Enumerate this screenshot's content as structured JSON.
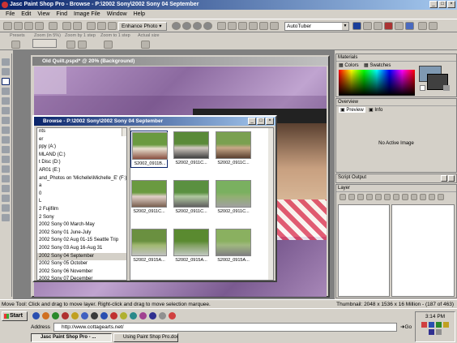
{
  "app": {
    "title": "Jasc Paint Shop Pro - Browse - P:\\2002 Sony\\2002 Sony 04 September"
  },
  "menu": [
    "File",
    "Edit",
    "View",
    "Find",
    "Image File",
    "Window",
    "Help"
  ],
  "toolbar": {
    "enhance_label": "Enhance Photo",
    "script_combo": "AutoTuber"
  },
  "options_bar": {
    "labels": [
      "Presets",
      "Zoom (in 5%)",
      "Zoom by 1 step",
      "Zoom to 1 step",
      "Actual size"
    ]
  },
  "document": {
    "title": "Old Quilt.pspd* @ 20% (Background)"
  },
  "browse": {
    "title": "Browse - P:\\2002 Sony\\2002 Sony 04 September",
    "tree": [
      "nts",
      "er",
      "ppy (A:)",
      "MLAND (C:)",
      "t Disc (D:)",
      "AR01 (E:)",
      "and_Photos on 'Michelle\\Michelle_E' (F:)",
      "a",
      "0",
      "L",
      "2 Fujifilm",
      "2 Sony",
      "2002 Sony 00 March-May",
      "2002 Sony 01 June-July",
      "2002 Sony 02 Aug 01-15 Seattle Trip",
      "2002 Sony 03 Aug 16-Aug 31",
      "2002 Sony 04 September",
      "2002 Sony 05 October",
      "2002 Sony 06 November",
      "2002 Sony 07 December"
    ],
    "selected_index": 16,
    "thumbs": [
      "S2002_0911B...",
      "S2002_0911C...",
      "S2002_0911C...",
      "S2002_0911C...",
      "S2002_0911C...",
      "S2002_0911C...",
      "S2002_0915A...",
      "S2002_0915A...",
      "S2002_0915A..."
    ]
  },
  "panels": {
    "materials": "Materials",
    "colors_tab": "Colors",
    "swatches_tab": "Swatches",
    "overview": "Overview",
    "preview_tab": "Preview",
    "info_tab": "Info",
    "no_image": "No Active Image",
    "script_output": "Script Output",
    "layer": "Layer"
  },
  "status": {
    "left": "Move Tool: Click and drag to move layer. Right-click and drag to move selection marquee.",
    "right": "Thumbnail: 2048 x 1536 x 16 Million - (187 of 463)"
  },
  "taskbar": {
    "start": "Start",
    "address_label": "Address",
    "address": "http://www.cottagearts.net/",
    "go": "Go",
    "time": "3:14 PM",
    "tasks": [
      "Jasc Paint Shop Pro - ...",
      "Using Paint Shop Pro.doc ..."
    ]
  }
}
